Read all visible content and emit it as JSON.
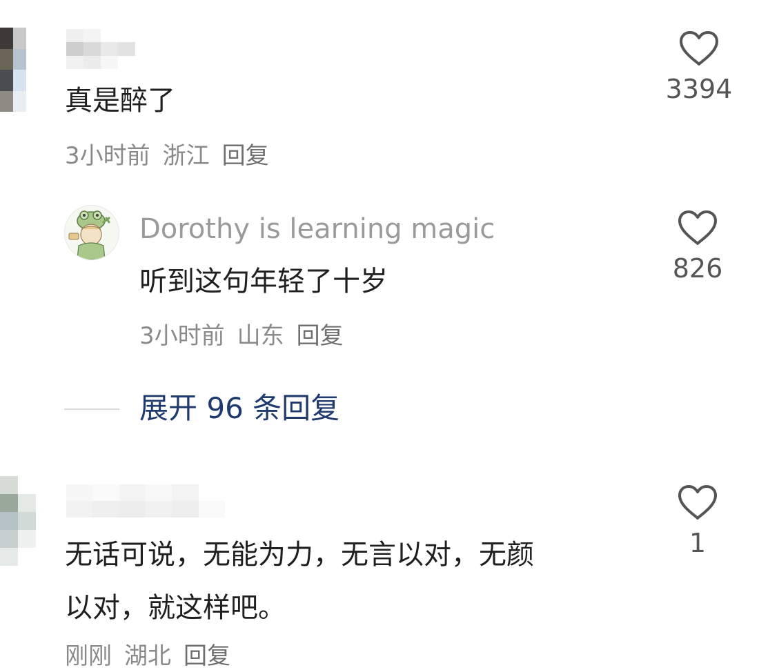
{
  "comments": [
    {
      "text": "真是醉了",
      "time": "3小时前",
      "location": "浙江",
      "reply_label": "回复",
      "likes": "3394",
      "replies": [
        {
          "username": "Dorothy is learning magic",
          "text": "听到这句年轻了十岁",
          "time": "3小时前",
          "location": "山东",
          "reply_label": "回复",
          "likes": "826"
        }
      ],
      "expand_label": "展开 96 条回复"
    },
    {
      "text_line1": "无话可说，无能为力，无言以对，无颜",
      "text_line2": "以对，就这样吧。",
      "time": "刚刚",
      "location": "湖北",
      "reply_label": "回复",
      "likes": "1"
    }
  ],
  "icons": {
    "like": "heart-outline-icon"
  },
  "colors": {
    "expand_link": "#1e3a6e",
    "meta": "#8a8a8a",
    "username": "#9a9a9a"
  }
}
